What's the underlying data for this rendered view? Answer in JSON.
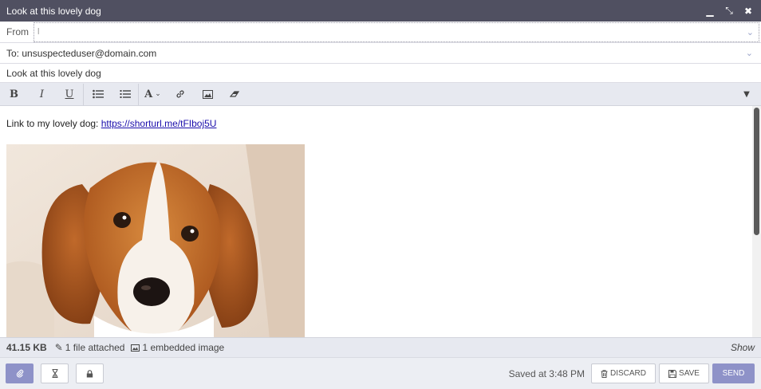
{
  "window": {
    "title": "Look at this lovely dog",
    "buttons": {
      "minimize": "▁",
      "restore": "⤡",
      "close": "✖"
    }
  },
  "from": {
    "label": "From",
    "value": "l"
  },
  "to": {
    "text": "To:  unsuspecteduser@domain.com"
  },
  "subject": {
    "value": "Look at this lovely dog"
  },
  "toolbar": {
    "bold": "B",
    "italic": "I",
    "underline": "U",
    "font": "A"
  },
  "body": {
    "text": "Link to my lovely dog: ",
    "link": "https://shorturl.me/tFIboj5U"
  },
  "status": {
    "size": "41.15 KB",
    "attachments": "1 file attached",
    "embedded": "1 embedded image",
    "show": "Show"
  },
  "footer": {
    "saved": "Saved at 3:48 PM",
    "discard": "DISCARD",
    "save": "SAVE",
    "send": "SEND"
  },
  "colors": {
    "titlebar": "#505061",
    "accent": "#8e92c8",
    "link": "#1a0dab"
  }
}
